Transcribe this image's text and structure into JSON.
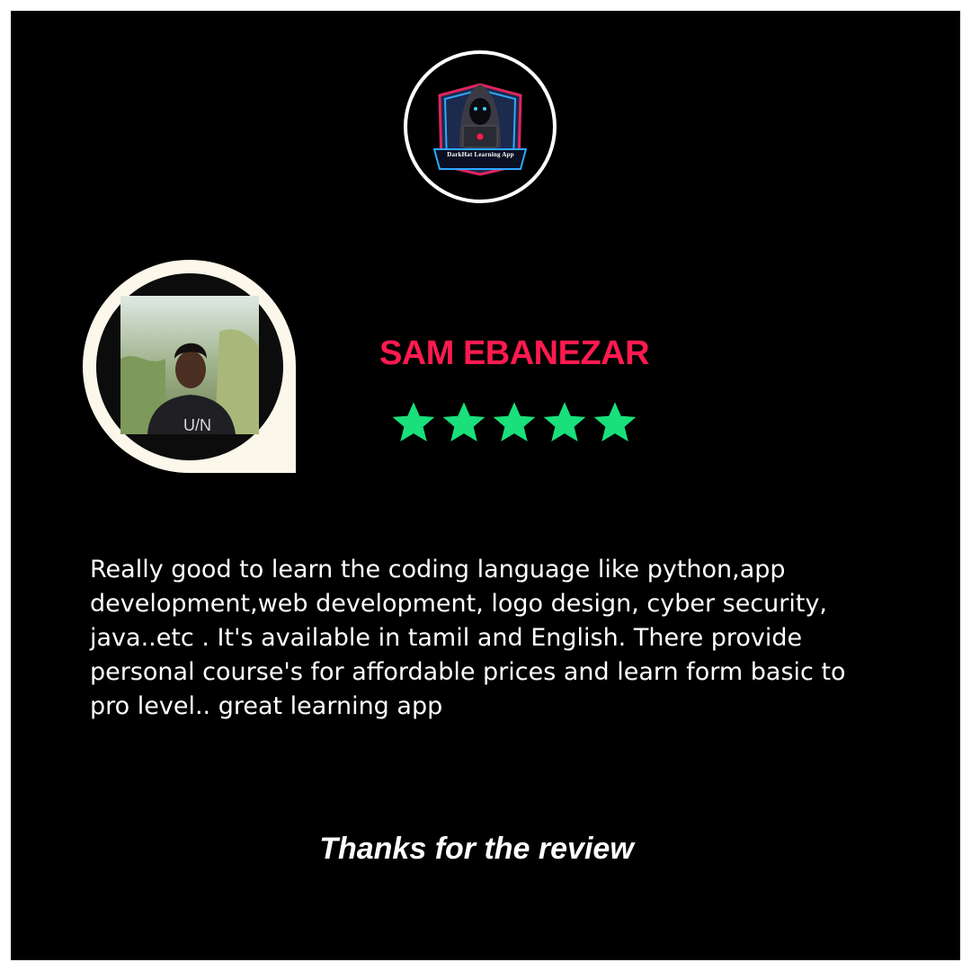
{
  "logo": {
    "caption": "DarkHat Learning App",
    "icon": "hooded-hacker-laptop-badge-icon"
  },
  "reviewer": {
    "name": "SAM EBANEZAR",
    "avatar_icon": "reviewer-photo",
    "rating": 5,
    "rating_max": 5
  },
  "review": {
    "text": "Really good to learn the coding language like python,app development,web development, logo design, cyber security, java..etc . It's available in tamil and English. There provide personal course's for affordable prices and learn form basic to pro level.. great learning app"
  },
  "footer": {
    "thanks": "Thanks for the review"
  },
  "colors": {
    "background": "#000000",
    "name": "#ff1a4f",
    "stars": "#19e07a",
    "text": "#ffffff",
    "avatar_frame": "#fbf7ea"
  }
}
